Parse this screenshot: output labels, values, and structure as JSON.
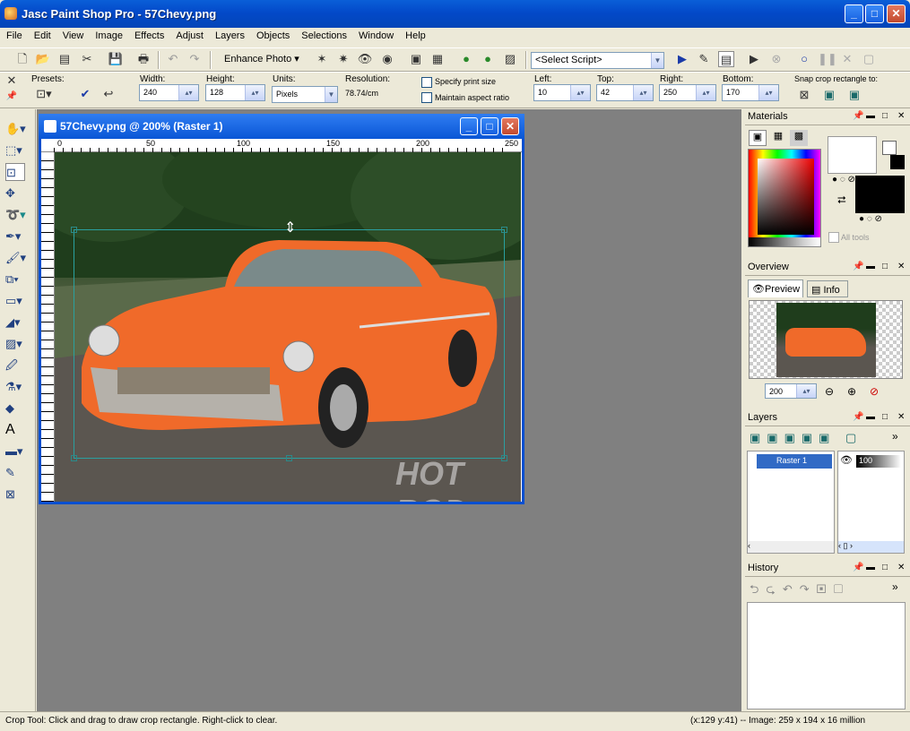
{
  "app": {
    "title": "Jasc Paint Shop Pro - 57Chevy.png"
  },
  "menu": [
    "File",
    "Edit",
    "View",
    "Image",
    "Effects",
    "Adjust",
    "Layers",
    "Objects",
    "Selections",
    "Window",
    "Help"
  ],
  "toolbar": {
    "enhance_photo": "Enhance Photo",
    "script_select": "<Select Script>"
  },
  "tool_options": {
    "presets_label": "Presets:",
    "width_label": "Width:",
    "width_value": "240",
    "height_label": "Height:",
    "height_value": "128",
    "units_label": "Units:",
    "units_value": "Pixels",
    "resolution_label": "Resolution:",
    "resolution_value": "78.74/cm",
    "specify_print": "Specify print size",
    "maintain_aspect": "Maintain aspect ratio",
    "left_label": "Left:",
    "left_value": "10",
    "top_label": "Top:",
    "top_value": "42",
    "right_label": "Right:",
    "right_value": "250",
    "bottom_label": "Bottom:",
    "bottom_value": "170",
    "snap_label": "Snap crop rectangle to:"
  },
  "image_window": {
    "title": "57Chevy.png @ 200% (Raster 1)",
    "ruler_ticks": [
      "0",
      "50",
      "100",
      "150",
      "200",
      "250"
    ],
    "watermark": "HOT ROD"
  },
  "panels": {
    "materials": {
      "title": "Materials",
      "all_tools": "All tools"
    },
    "overview": {
      "title": "Overview",
      "tab_preview": "Preview",
      "tab_info": "Info",
      "zoom": "200"
    },
    "layers": {
      "title": "Layers",
      "layer_name": "Raster 1",
      "opacity": "100"
    },
    "history": {
      "title": "History"
    }
  },
  "status": {
    "left": "Crop Tool: Click and drag to draw crop rectangle. Right-click to clear.",
    "right": "(x:129 y:41) -- Image:  259 x 194 x 16 million"
  },
  "colors": {
    "title_blue": "#0a4fd0",
    "car_orange": "#f06a2a",
    "workspace": "#808080"
  },
  "icons": [
    "hand-icon",
    "select-icon",
    "crop-icon",
    "move-icon",
    "lasso-icon",
    "dropper-icon",
    "paintbrush-icon",
    "clone-icon",
    "eraser-icon",
    "fill-icon",
    "text-icon",
    "shape-icon",
    "pen-icon"
  ]
}
